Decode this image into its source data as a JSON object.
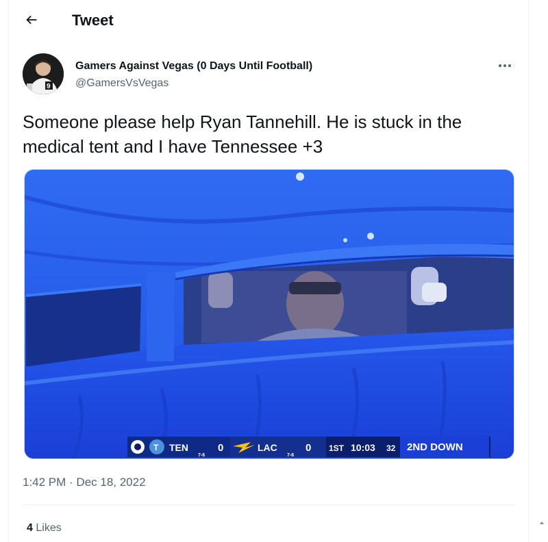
{
  "header": {
    "back_icon": "arrow-left-icon",
    "title": "Tweet"
  },
  "tweet": {
    "author": {
      "display_name": "Gamers Against Vegas (0 Days Until Football)",
      "handle": "@GamersVsVegas",
      "avatar_icon": "profile-avatar"
    },
    "more_icon": "more-horizontal-icon",
    "text": "Someone please help Ryan Tannehill. He is stuck in the medical tent and I have Tennessee +3",
    "media": {
      "kind": "photo",
      "scorebug": {
        "network_icon": "cbs-eye-icon",
        "team1": "TEN",
        "team1_record": "7-6",
        "team1_score": "0",
        "team2": "LAC",
        "team2_record": "7-6",
        "team2_score": "0",
        "quarter": "1ST",
        "clock": "10:03",
        "play_clock": "32",
        "down": "2ND DOWN"
      }
    },
    "timestamp": "1:42 PM · Dec 18, 2022",
    "likes_count": "4",
    "likes_label": "Likes"
  },
  "colors": {
    "text_primary": "#0f1419",
    "text_secondary": "#536471",
    "divider": "#eff3f4",
    "tent_blue": "#1f52e8",
    "scorebug_bg": "#0b1e6b"
  }
}
